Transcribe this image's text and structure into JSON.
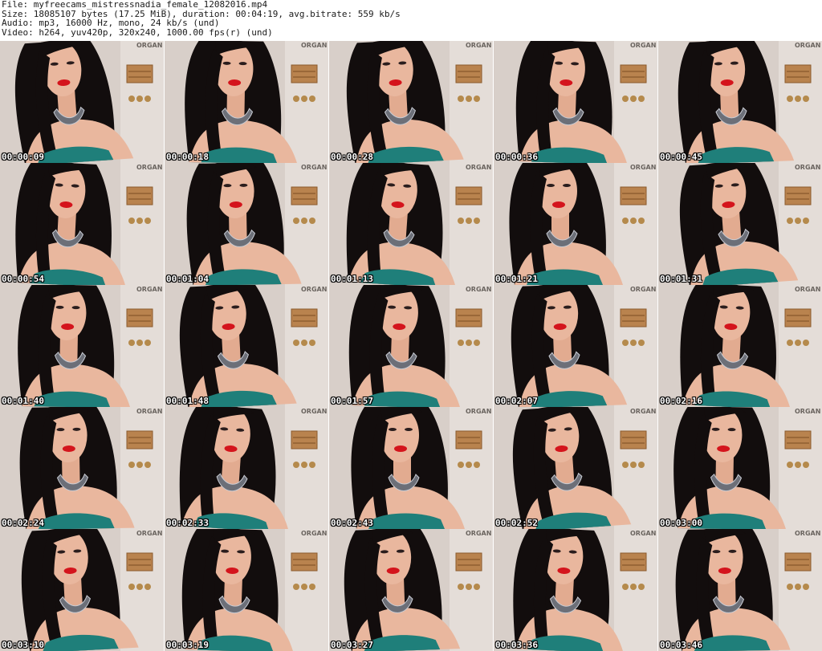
{
  "header": {
    "file": "File: myfreecams_mistressnadia_female_12082016.mp4",
    "size": "Size: 18085107 bytes (17.25 MiB), duration: 00:04:19, avg.bitrate: 559 kb/s",
    "audio": "Audio: mp3, 16000 Hz, mono, 24 kb/s (und)",
    "video": "Video: h264, yuv420p, 320x240, 1000.00 fps(r) (und)"
  },
  "sign_text": "ORGAN",
  "frames": [
    {
      "time": "00:00:09"
    },
    {
      "time": "00:00:18"
    },
    {
      "time": "00:00:28"
    },
    {
      "time": "00:00:36"
    },
    {
      "time": "00:00:45"
    },
    {
      "time": "00:00:54"
    },
    {
      "time": "00:01:04"
    },
    {
      "time": "00:01:13"
    },
    {
      "time": "00:01:21"
    },
    {
      "time": "00:01:31"
    },
    {
      "time": "00:01:40"
    },
    {
      "time": "00:01:48"
    },
    {
      "time": "00:01:57"
    },
    {
      "time": "00:02:07"
    },
    {
      "time": "00:02:16"
    },
    {
      "time": "00:02:24"
    },
    {
      "time": "00:02:33"
    },
    {
      "time": "00:02:43"
    },
    {
      "time": "00:02:52"
    },
    {
      "time": "00:03:00"
    },
    {
      "time": "00:03:10"
    },
    {
      "time": "00:03:19"
    },
    {
      "time": "00:03:27"
    },
    {
      "time": "00:03:36"
    },
    {
      "time": "00:03:46"
    }
  ],
  "colors": {
    "wall": "#d8cfc9",
    "hair": "#120d0d",
    "skin": "#e9b79e",
    "lips": "#d4141c",
    "dress": "#1f7f7a",
    "necklace": "#6c6f78",
    "shelf": "#b9834e",
    "timestamp": "#ffffff"
  }
}
